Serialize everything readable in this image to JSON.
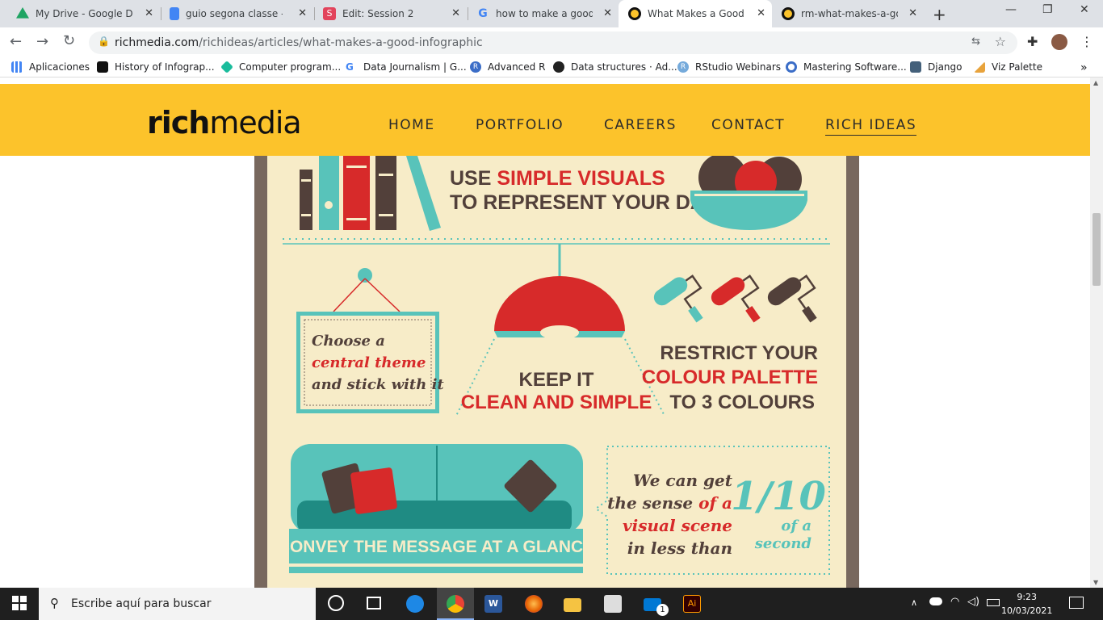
{
  "browser": {
    "tabs": [
      {
        "title": "My Drive - Google Drive",
        "favicon_color": "#1fa463"
      },
      {
        "title": "guio segona classe - Google Docs",
        "favicon_color": "#4285f4"
      },
      {
        "title": "Edit: Session 2",
        "favicon_color": "#e2445c"
      },
      {
        "title": "how to make a good infographic",
        "favicon_color": "#ffffff"
      },
      {
        "title": "What Makes a Good Infographic",
        "favicon_color": "#111111"
      },
      {
        "title": "rm-what-makes-a-good-infographic",
        "favicon_color": "#111111"
      }
    ],
    "active_tab": 4,
    "url_host": "richmedia.com",
    "url_path": "/richideas/articles/what-makes-a-good-infographic",
    "bookmarks": [
      {
        "label": "Aplicaciones",
        "color": "#4285f4"
      },
      {
        "label": "History of Infograp...",
        "color": "#111111"
      },
      {
        "label": "Computer program...",
        "color": "#1abc9c"
      },
      {
        "label": "Data Journalism | G...",
        "color": "#4285f4"
      },
      {
        "label": "Advanced R",
        "color": "#3b6dc7"
      },
      {
        "label": "Data structures · Ad...",
        "color": "#222222"
      },
      {
        "label": "RStudio Webinars",
        "color": "#75aadb"
      },
      {
        "label": "Mastering Software...",
        "color": "#3b6dc7"
      },
      {
        "label": "Django",
        "color": "#44607a"
      },
      {
        "label": "Viz Palette",
        "color": "#e8a33c"
      }
    ],
    "more_bookmarks": "»"
  },
  "site": {
    "logo_bold": "rich",
    "logo_light": "media",
    "nav": [
      "HOME",
      "PORTFOLIO",
      "CAREERS",
      "CONTACT",
      "RICH IDEAS"
    ],
    "brand_color": "#fcc32b"
  },
  "infographic": {
    "simple_visuals": {
      "line1_a": "USE ",
      "line1_b": "SIMPLE VISUALS",
      "line2": "TO REPRESENT YOUR DATA"
    },
    "theme": {
      "line1": "Choose a",
      "line2": "central theme",
      "line3": "and stick with it"
    },
    "clean": {
      "line1": "KEEP IT",
      "line2": "CLEAN AND SIMPLE"
    },
    "palette": {
      "line1": "RESTRICT YOUR",
      "line2": "COLOUR PALETTE",
      "line3": "TO 3 COLOURS"
    },
    "glance": "CONVEY THE MESSAGE AT A GLANCE",
    "scene": {
      "line1": "We can get",
      "line2_a": "the sense ",
      "line2_b": "of a",
      "line3": "visual scene",
      "line4": "in less than",
      "fraction": "1/10",
      "of_a": "of a",
      "second": "second"
    },
    "colors": {
      "cream": "#f7ecc8",
      "teal": "#58c3ba",
      "red": "#d72a2a",
      "brown": "#52403a",
      "frame": "#78685e"
    }
  },
  "taskbar": {
    "search_placeholder": "Escribe aquí para buscar",
    "time": "9:23",
    "date": "10/03/2021",
    "mail_badge": "1",
    "ai_label": "Ai"
  }
}
